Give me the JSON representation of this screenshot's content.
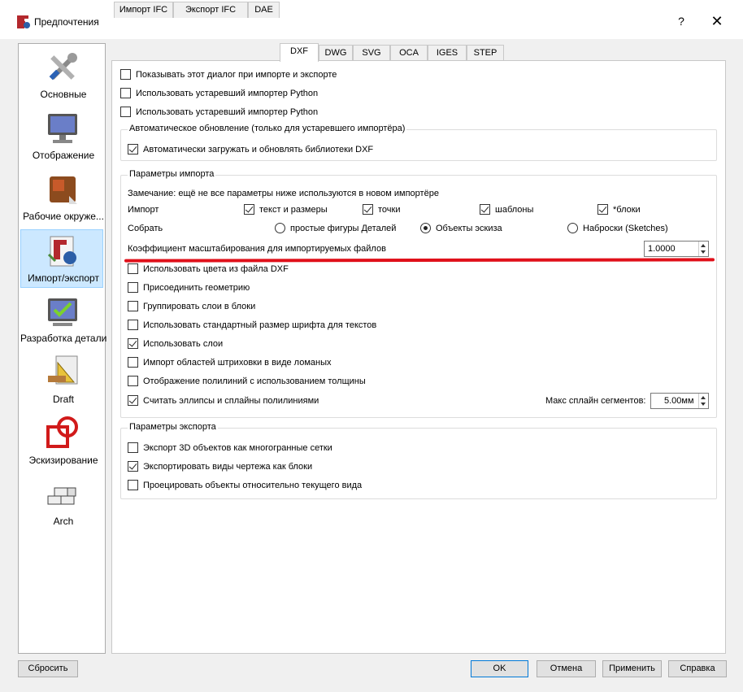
{
  "window": {
    "title": "Предпочтения",
    "help": "?",
    "close": "✕"
  },
  "sidebar": {
    "items": [
      {
        "label": "Основные",
        "icon": "tools-icon"
      },
      {
        "label": "Отображение",
        "icon": "monitor-icon"
      },
      {
        "label": "Рабочие окруже...",
        "icon": "workbench-icon"
      },
      {
        "label": "Импорт/экспорт",
        "icon": "import-export-icon"
      },
      {
        "label": "Разработка детали",
        "icon": "part-design-icon"
      },
      {
        "label": "Draft",
        "icon": "draft-icon"
      },
      {
        "label": "Эскизирование",
        "icon": "sketcher-icon"
      },
      {
        "label": "Arch",
        "icon": "arch-icon"
      }
    ]
  },
  "tabs": [
    "Импорт IFC",
    "Экспорт IFC",
    "DAE",
    "DXF",
    "DWG",
    "SVG",
    "OCA",
    "IGES",
    "STEP"
  ],
  "general": {
    "show_dialog": "Показывать этот диалог при импорте и экспорте",
    "legacy_importer": "Использовать устаревший импортер Python",
    "legacy_exporter": "Использовать устаревший импортер Python"
  },
  "auto_update": {
    "title": "Автоматическое обновление (только для устаревшего импортёра)",
    "auto_load": "Автоматически загружать и обновлять библиотеки DXF"
  },
  "import_params": {
    "title": "Параметры импорта",
    "note": "Замечание: ещё не все параметры ниже используются в новом импортёре",
    "import_label": "Импорт",
    "import_texts": "текст и размеры",
    "import_points": "точки",
    "import_layouts": "шаблоны",
    "import_blocks": "*блоки",
    "create_label": "Собрать",
    "create_simple": "простые фигуры Деталей",
    "create_sketch_objects": "Объекты эскиза",
    "create_sketches": "Наброски (Sketches)",
    "scale_label": "Коэффициент масштабирования для импортируемых файлов",
    "scale_value": "1.0000",
    "use_colors": "Использовать цвета из файла DXF",
    "join_geometry": "Присоединить геометрию",
    "group_layers": "Группировать слои в блоки",
    "std_font_size": "Использовать стандартный размер шрифта для текстов",
    "use_layers": "Использовать слои",
    "hatch_polylines": "Импорт областей штриховки в виде ломаных",
    "polyline_width": "Отображение полилиний с использованием толщины",
    "ellipse_polylines": "Считать эллипсы и сплайны полилиниями",
    "max_spline_label": "Макс сплайн сегментов:",
    "max_spline_value": "5.00мм"
  },
  "export_params": {
    "title": "Параметры экспорта",
    "export_3d": "Экспорт 3D объектов как многогранные сетки",
    "export_drawing_views": "Экспортировать виды чертежа как блоки",
    "project_objects": "Проецировать объекты относительно текущего вида"
  },
  "buttons": {
    "reset": "Сбросить",
    "ok": "OK",
    "cancel": "Отмена",
    "apply": "Применить",
    "help": "Справка"
  },
  "colors": {
    "accent": "#0078d7",
    "annotation_red": "#e0101a",
    "selection": "#cce8ff"
  }
}
